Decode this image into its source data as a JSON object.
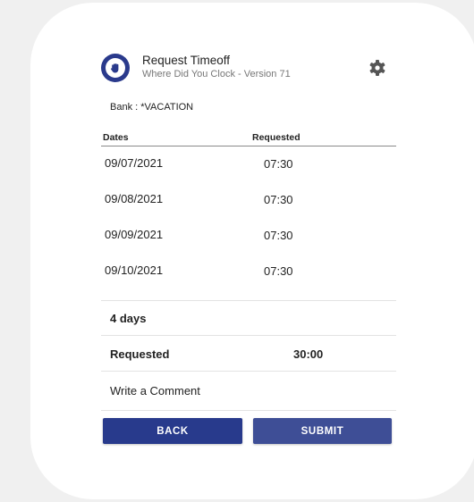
{
  "header": {
    "title": "Request Timeoff",
    "subtitle": "Where Did You Clock - Version 71",
    "logo_icon": "hand-badge-icon",
    "settings_icon": "gear-icon"
  },
  "bank": {
    "label": "Bank : *VACATION"
  },
  "table": {
    "columns": [
      "Dates",
      "Requested"
    ],
    "rows": [
      {
        "date": "09/07/2021",
        "hours": "07:30"
      },
      {
        "date": "09/08/2021",
        "hours": "07:30"
      },
      {
        "date": "09/09/2021",
        "hours": "07:30"
      },
      {
        "date": "09/10/2021",
        "hours": "07:30"
      }
    ]
  },
  "summary": {
    "days": "4 days",
    "requested_label": "Requested",
    "requested_total": "30:00"
  },
  "comment": {
    "placeholder": "Write a Comment"
  },
  "actions": {
    "back_label": "BACK",
    "submit_label": "SUBMIT"
  },
  "colors": {
    "primary": "#283a8c",
    "primary_light": "#3e4e96",
    "background": "#f0f0f0",
    "card": "#ffffff"
  }
}
